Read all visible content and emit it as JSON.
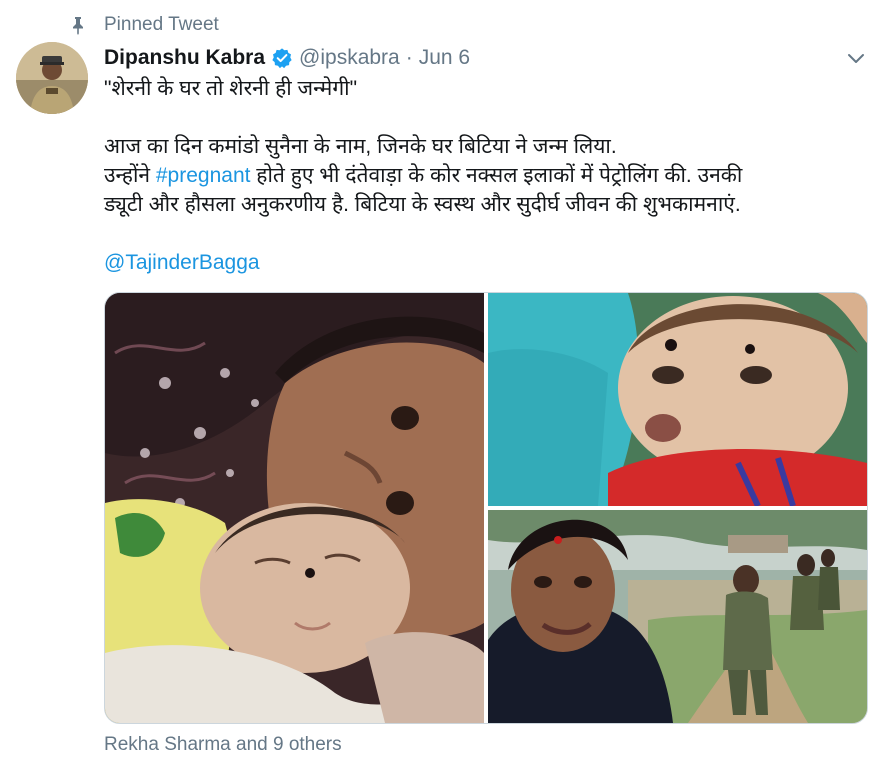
{
  "pinned": {
    "label": "Pinned Tweet",
    "icon": "pin-icon"
  },
  "author": {
    "name": "Dipanshu Kabra",
    "handle": "@ipskabra",
    "separator": "·",
    "date": "Jun 6",
    "verified": true
  },
  "tweet": {
    "line1": "\"शेरनी के घर तो शेरनी ही जन्मेगी\"",
    "line2": "आज का दिन कमांडो सुनैना के नाम, जिनके घर बिटिया ने जन्म लिया.",
    "line3_before": "उन्होंने ",
    "hashtag": "#pregnant",
    "line3_after": " होते हुए भी दंतेवाड़ा के कोर नक्सल इलाकों में पेट्रोलिंग की. उनकी",
    "line4": "ड्यूटी और हौसला अनुकरणीय है. बिटिया के स्वस्थ और सुदीर्घ जीवन की शुभकामनाएं.",
    "mention": "@TajinderBagga"
  },
  "media": {
    "photo_count": 3
  },
  "liked_by": "Rekha Sharma and 9 others",
  "colors": {
    "link": "#1b95e0",
    "verified": "#1da1f2",
    "secondary_text": "#657786",
    "primary_text": "#14171a",
    "border": "#ccd6dd"
  }
}
